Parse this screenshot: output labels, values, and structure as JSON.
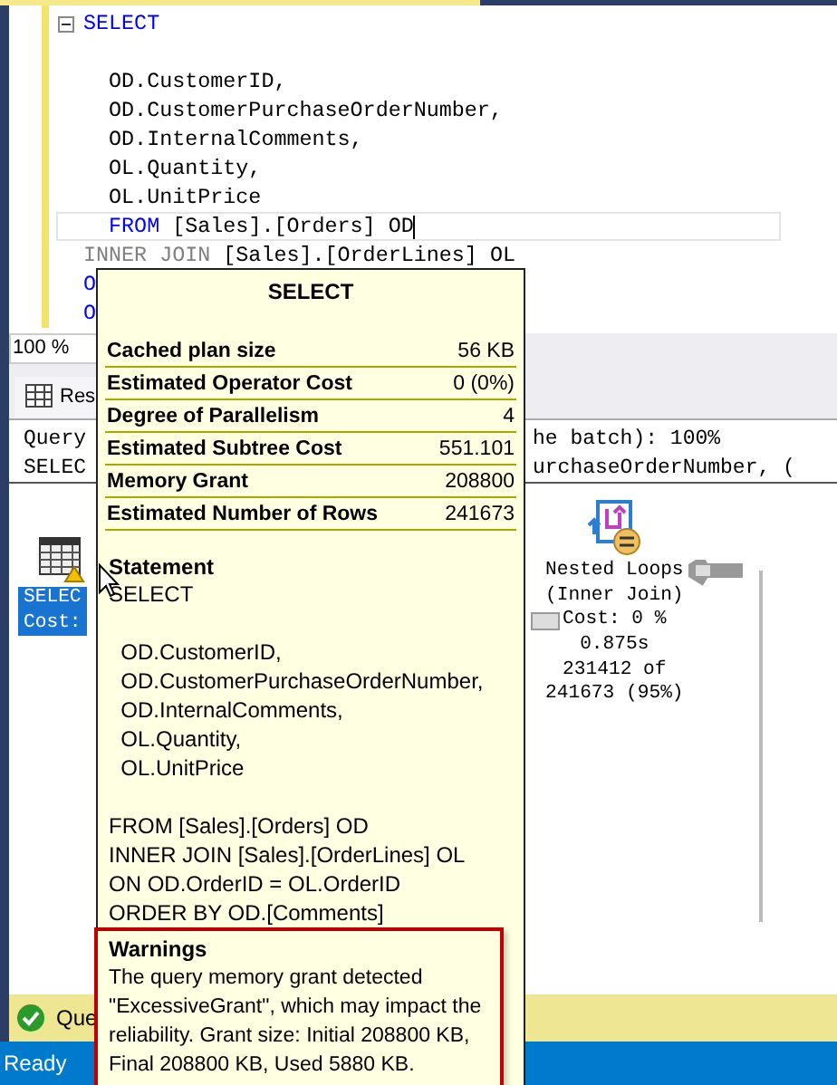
{
  "editor": {
    "lines": [
      {
        "collapsible": true,
        "current": false,
        "tokens": [
          {
            "text": "SELECT",
            "kind": "keyword"
          }
        ]
      },
      {
        "collapsible": false,
        "current": false,
        "space_before": true,
        "tokens": [
          {
            "text": "  OD.CustomerID,",
            "kind": "plain"
          }
        ]
      },
      {
        "collapsible": false,
        "current": false,
        "tokens": [
          {
            "text": "  OD.CustomerPurchaseOrderNumber,",
            "kind": "plain"
          }
        ]
      },
      {
        "collapsible": false,
        "current": false,
        "tokens": [
          {
            "text": "  OD.InternalComments,",
            "kind": "plain"
          }
        ]
      },
      {
        "collapsible": false,
        "current": false,
        "tokens": [
          {
            "text": "  OL.Quantity,",
            "kind": "plain"
          }
        ]
      },
      {
        "collapsible": false,
        "current": false,
        "tokens": [
          {
            "text": "  OL.UnitPrice",
            "kind": "plain"
          }
        ]
      },
      {
        "collapsible": false,
        "current": true,
        "tokens": [
          {
            "text": "  FROM",
            "kind": "keyword"
          },
          {
            "text": " [Sales].[Orders] OD",
            "kind": "plain"
          }
        ]
      },
      {
        "collapsible": false,
        "current": false,
        "tokens": [
          {
            "text": "INNER JOIN",
            "kind": "operator"
          },
          {
            "text": " [Sales].[OrderLines] OL",
            "kind": "plain"
          }
        ]
      },
      {
        "collapsible": false,
        "current": false,
        "tokens": [
          {
            "text": "O",
            "kind": "keyword"
          }
        ]
      },
      {
        "collapsible": false,
        "current": false,
        "tokens": [
          {
            "text": "O",
            "kind": "keyword"
          }
        ]
      }
    ]
  },
  "zoom": {
    "value": "100 %"
  },
  "results_tabs": [
    {
      "label": "Res",
      "selected": true
    }
  ],
  "messages": [
    {
      "left": "Query",
      "right": "he batch): 100%"
    },
    {
      "left": "SELEC",
      "right": "urchaseOrderNumber, ("
    }
  ],
  "plan": {
    "nodes": [
      {
        "kind": "select",
        "selected": true,
        "lines": [
          "SELEC",
          "Cost:"
        ]
      },
      {
        "kind": "nested_loops",
        "selected": false,
        "lines": [
          "Nested Loops",
          "(Inner Join)",
          "Cost: 0 %",
          "0.875s",
          "231412 of",
          "241673 (95%)"
        ]
      }
    ]
  },
  "tooltip": {
    "title": "SELECT",
    "rows": [
      {
        "label": "Cached plan size",
        "value": "56 KB"
      },
      {
        "label": "Estimated Operator Cost",
        "value": "0 (0%)"
      },
      {
        "label": "Degree of Parallelism",
        "value": "4"
      },
      {
        "label": "Estimated Subtree Cost",
        "value": "551.101"
      },
      {
        "label": "Memory Grant",
        "value": "208800"
      },
      {
        "label": "Estimated Number of Rows",
        "value": "241673"
      }
    ],
    "statement_heading": "Statement",
    "statement_blocks": [
      [
        "SELECT"
      ],
      [
        "  OD.CustomerID,",
        "  OD.CustomerPurchaseOrderNumber,",
        "  OD.InternalComments,",
        "  OL.Quantity,",
        "  OL.UnitPrice"
      ],
      [
        "FROM [Sales].[Orders] OD",
        "INNER JOIN [Sales].[OrderLines] OL",
        "ON OD.OrderID = OL.OrderID",
        "ORDER BY OD.[Comments]"
      ]
    ],
    "warnings_heading": "Warnings",
    "warnings_text": "The query memory grant detected \"ExcessiveGrant\", which may impact the reliability. Grant size: Initial 208800 KB, Final 208800 KB, Used 5880 KB."
  },
  "query_status": {
    "text": "Que",
    "ok": true
  },
  "status_bar": {
    "text": "Ready"
  }
}
